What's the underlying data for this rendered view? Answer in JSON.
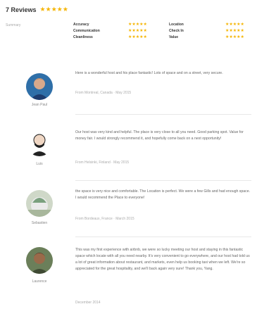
{
  "header": {
    "title": "7 Reviews",
    "rating_icon": "star-icon"
  },
  "summary": {
    "label": "Summary",
    "categories": [
      {
        "name": "Accuracy"
      },
      {
        "name": "Communication"
      },
      {
        "name": "Cleanliness"
      },
      {
        "name": "Location"
      },
      {
        "name": "Check In"
      },
      {
        "name": "Value"
      }
    ]
  },
  "reviews": [
    {
      "name": "Jean Paul",
      "text": "Here is a wonderful host and his place fantastic! Lots of space and on a street, very secure.",
      "meta": "From Montreal, Canada · May 2015"
    },
    {
      "name": "Luis",
      "text": "Our host was very kind and helpful. The place is very close to all you need. Good parking spot. Value for money fair. I would strongly recommend it, and hopefully come back on a next opportunity!",
      "meta": "From Helsinki, Finland · May 2015"
    },
    {
      "name": "Sebastien",
      "text": "the space is very nice and comfortable. The Location is perfect. We were a few Gills and had enough space. I would recommend the Place to everyone!",
      "meta": "From Bordeaux, France · March 2015"
    },
    {
      "name": "Laurence",
      "text": "This was my first experience with airbnb, we were so lucky meeting our host and staying in this fantastic space which locate with all you need nearby. It's very convenient to go everywhere, and our host had told us a lot of great information about restaurant, and markets, even help us booking taxi when we left. We're so appreciated for the great hospitality, and we'll back again very sure! Thank you, Yang.",
      "meta": "December 2014"
    }
  ],
  "colors": {
    "star": "#f5b400",
    "text": "#484848",
    "muted": "#aaaaaa"
  }
}
